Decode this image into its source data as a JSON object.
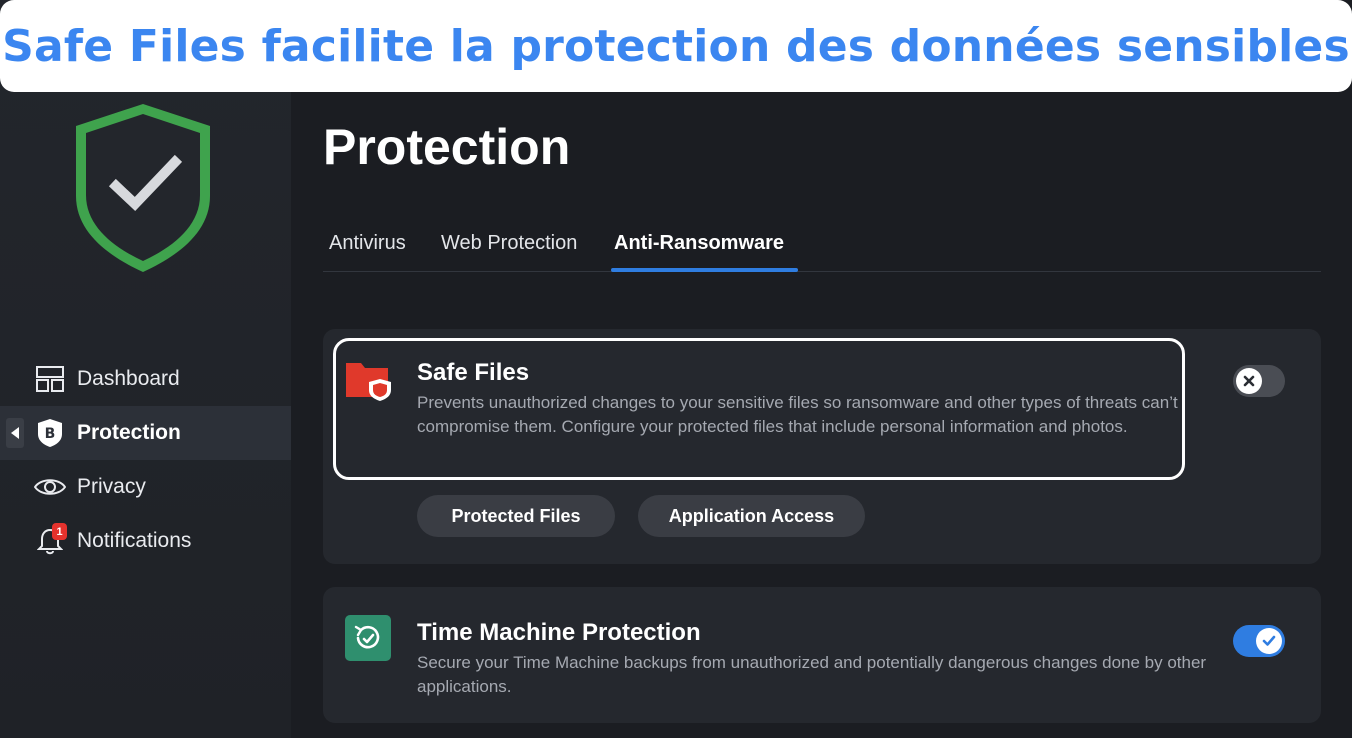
{
  "banner": {
    "caption": "Safe Files facilite la protection des données sensibles"
  },
  "sidebar": {
    "logo_icon": "shield-check-icon",
    "items": [
      {
        "label": "Dashboard",
        "icon": "dashboard-icon",
        "active": false
      },
      {
        "label": "Protection",
        "icon": "bitdefender-b-icon",
        "active": true
      },
      {
        "label": "Privacy",
        "icon": "eye-icon",
        "active": false
      },
      {
        "label": "Notifications",
        "icon": "bell-icon",
        "active": false,
        "badge": "1"
      }
    ]
  },
  "main": {
    "title": "Protection",
    "tabs": [
      {
        "label": "Antivirus",
        "active": false
      },
      {
        "label": "Web Protection",
        "active": false
      },
      {
        "label": "Anti-Ransomware",
        "active": true
      }
    ],
    "cards": [
      {
        "title": "Safe Files",
        "icon": "folder-shield-icon",
        "description": "Prevents unauthorized changes to your sensitive files so ransomware and other types of threats can’t compromise them. Configure your protected files that include personal information and photos.",
        "enabled": false,
        "buttons": [
          "Protected Files",
          "Application Access"
        ]
      },
      {
        "title": "Time Machine Protection",
        "icon": "time-machine-icon",
        "description": "Secure your Time Machine backups from unauthorized and potentially dangerous changes done by other applications.",
        "enabled": true
      }
    ]
  },
  "colors": {
    "accent": "#2f7de1",
    "banner_text": "#3b86f0",
    "shield_green": "#3fa34d",
    "folder_red": "#e0392b",
    "tm_teal": "#2f8f6e"
  }
}
